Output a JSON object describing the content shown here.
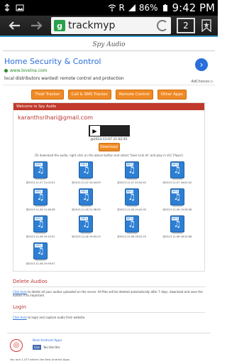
{
  "status": {
    "battery": "86%",
    "carrier": "R",
    "time": "9:42 PM"
  },
  "browser": {
    "url": "trackmyp",
    "tabs_count": "2"
  },
  "site": {
    "title": "Spy Audio"
  },
  "ad": {
    "title": "Home Security & Control",
    "url": "www.lovelna.com",
    "desc": "local distributors wanted! remote control and protection",
    "choices": "AdChoices ▷"
  },
  "nav": [
    "Thief Tracker",
    "Call & SMS Tracker",
    "Remote Control",
    "Other Apps"
  ],
  "panel": {
    "header": "Welcome to Spy Audio",
    "email": "karanthsrihari@gmail.com",
    "current_recording": "@2013-11-07 21:02:45",
    "download_label": "Download",
    "note": "(To download the audio, right click on the above button and select 'Save Link As' and play in VLC Player)"
  },
  "files": [
    "@2013-11-07 21:02:01",
    "@2013-11-07 20:44:03",
    "@2013-11-07 20:42:42",
    "@2013-11-07 18:02:42",
    "@2013-11-06 21:48:28",
    "@2013-11-06 21:38:55",
    "@2013-11-06 19:42:05",
    "@2013-11-06 19:28:36",
    "@2013-11-06 19:10:51",
    "@2013-11-06 19:05:13",
    "@2013-11-06 18:52:25",
    "@2013-11-06 18:24:08",
    "@2013-11-06 19:59:07"
  ],
  "delete_section": {
    "title": "Delete Audios",
    "link": "Click here",
    "text": " to delete all your audios uploaded on the server. All files will be deleted automatically after 7 days, download and save the audios if its important."
  },
  "login_section": {
    "title": "Login",
    "link": "Click here",
    "text": " to login and capture audio from website."
  },
  "facebook": {
    "page_name": "Best Android Apps",
    "like": "Like",
    "like_text": "You like this",
    "friends_text": "You and 1,473 others like Best Android Apps"
  },
  "colors": {
    "accent": "#f08a24",
    "header": "#c0392b",
    "link": "#2a6fdb"
  }
}
